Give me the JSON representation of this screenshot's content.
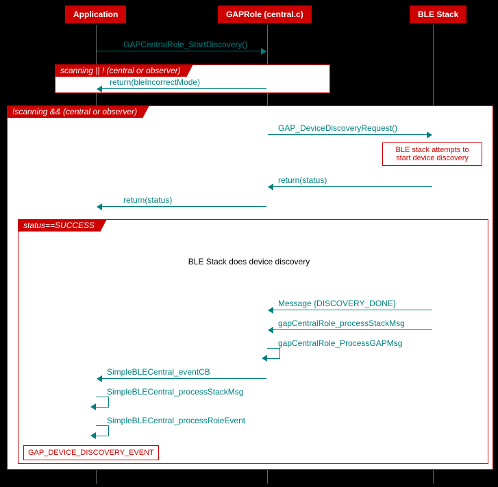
{
  "participants": {
    "app": "Application",
    "gap": "GAPRole (central.c)",
    "ble": "BLE Stack"
  },
  "group1": {
    "label": "scanning || ! (central or observer)",
    "msg1": "return(bleIncorrectMode)"
  },
  "group2": {
    "label": "!scanning && (central or observer)",
    "msg1": "GAP_DeviceDiscoveryRequest()",
    "note1a": "BLE stack attempts to",
    "note1b": "start device discovery",
    "msg2": "return(status)",
    "msg3": "return(status)"
  },
  "group3": {
    "label": "status==SUCCESS",
    "divider": "BLE Stack does device discovery",
    "msg1": "Message {DISCOVERY_DONE}",
    "msg2": "gapCentralRole_processStackMsg",
    "msg3": "gapCentralRole_ProcessGAPMsg",
    "msg4": "SimpleBLECentral_eventCB",
    "msg5": "SimpleBLECentral_processStackMsg",
    "msg6": "SimpleBLECentral_processRoleEvent",
    "note": "GAP_DEVICE_DISCOVERY_EVENT"
  },
  "firstMsg": "GAPCentralRole_StartDiscovery()"
}
